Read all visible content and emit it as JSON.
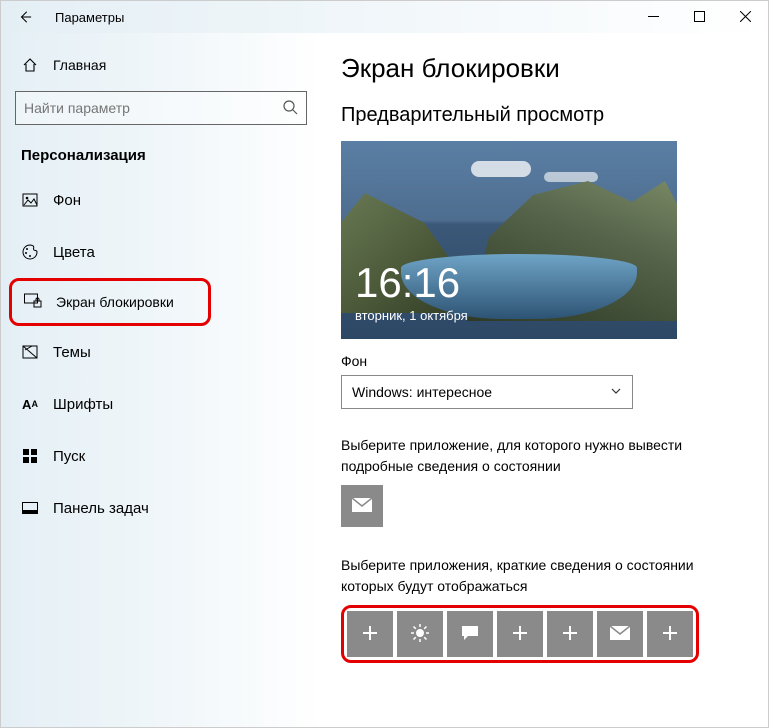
{
  "window": {
    "title": "Параметры"
  },
  "sidebar": {
    "home": "Главная",
    "search_placeholder": "Найти параметр",
    "section": "Персонализация",
    "items": [
      {
        "label": "Фон"
      },
      {
        "label": "Цвета"
      },
      {
        "label": "Экран блокировки"
      },
      {
        "label": "Темы"
      },
      {
        "label": "Шрифты"
      },
      {
        "label": "Пуск"
      },
      {
        "label": "Панель задач"
      }
    ]
  },
  "main": {
    "title": "Экран блокировки",
    "preview_label": "Предварительный просмотр",
    "clock_time": "16:16",
    "clock_date": "вторник, 1 октября",
    "bg_label": "Фон",
    "bg_value": "Windows: интересное",
    "detail_app_label": "Выберите приложение, для которого нужно вывести подробные сведения о состоянии",
    "quick_apps_label": "Выберите приложения, краткие сведения о состоянии которых будут отображаться"
  }
}
